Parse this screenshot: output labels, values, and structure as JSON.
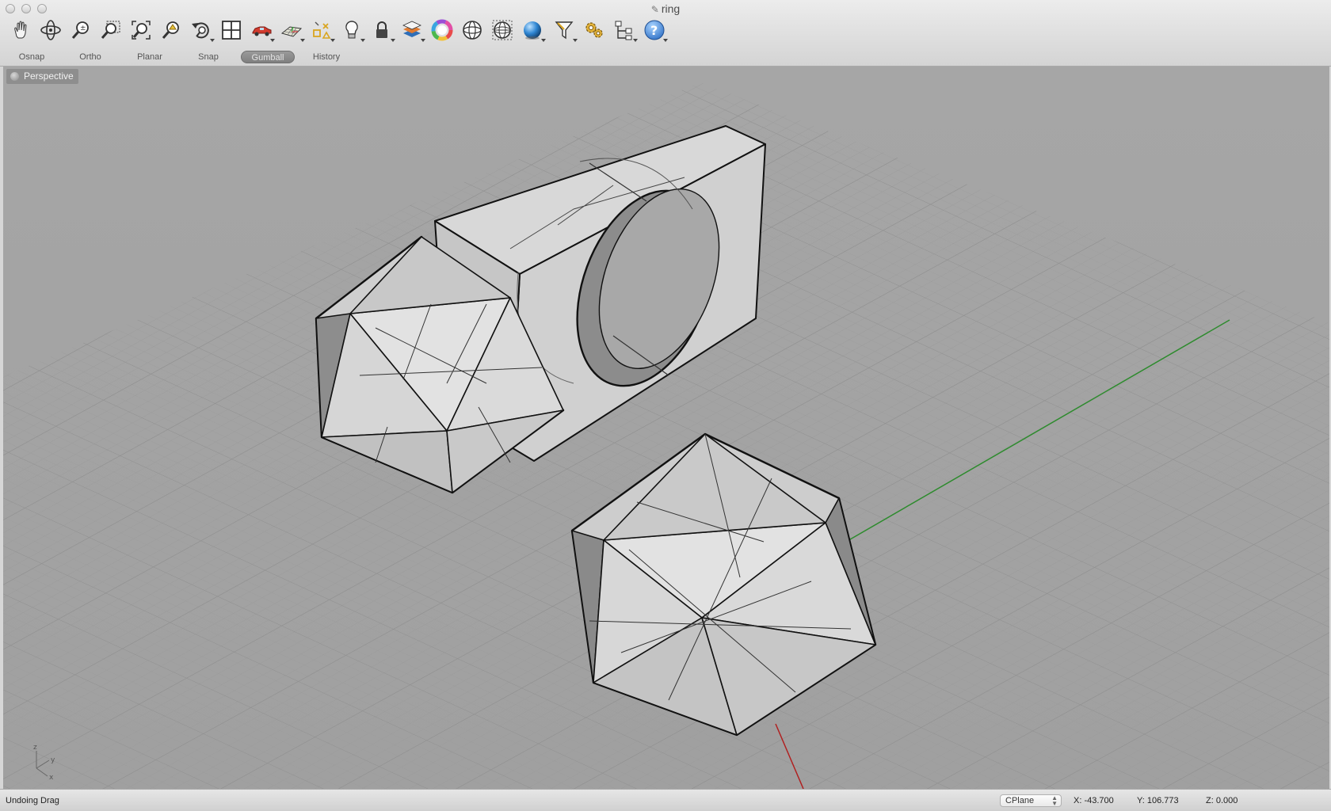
{
  "window": {
    "title": "ring"
  },
  "toolbar": {
    "tools": [
      {
        "icon": "pan-hand-icon",
        "caret": false
      },
      {
        "icon": "rotate-view-icon",
        "caret": false
      },
      {
        "icon": "zoom-icon",
        "caret": false
      },
      {
        "icon": "zoom-window-icon",
        "caret": false
      },
      {
        "icon": "zoom-extents-icon",
        "caret": false
      },
      {
        "icon": "zoom-selected-icon",
        "caret": false
      },
      {
        "icon": "undo-view-icon",
        "caret": true
      },
      {
        "icon": "viewport-layout-icon",
        "caret": false
      },
      {
        "icon": "car-render-icon",
        "caret": true
      },
      {
        "icon": "grid-plane-icon",
        "caret": true
      },
      {
        "icon": "object-snap-icon",
        "caret": true
      },
      {
        "icon": "lightbulb-icon",
        "caret": true
      },
      {
        "icon": "lock-icon",
        "caret": true
      },
      {
        "icon": "layer-icon",
        "caret": true
      },
      {
        "icon": "color-wheel-icon",
        "caret": false
      },
      {
        "icon": "sphere-wire-icon",
        "caret": false
      },
      {
        "icon": "globe-grid-icon",
        "caret": false
      },
      {
        "icon": "shaded-sphere-icon",
        "caret": true
      },
      {
        "icon": "filter-icon",
        "caret": true
      },
      {
        "icon": "settings-gears-icon",
        "caret": false
      },
      {
        "icon": "hierarchy-icon",
        "caret": true
      },
      {
        "icon": "help-icon",
        "caret": true
      }
    ]
  },
  "toggles": [
    {
      "label": "Osnap",
      "active": false
    },
    {
      "label": "Ortho",
      "active": false
    },
    {
      "label": "Planar",
      "active": false
    },
    {
      "label": "Snap",
      "active": false
    },
    {
      "label": "Gumball",
      "active": true
    },
    {
      "label": "History",
      "active": false
    }
  ],
  "viewport": {
    "name": "Perspective",
    "axes": {
      "x": "x",
      "y": "y",
      "z": "z"
    },
    "colors": {
      "background": "#a3a3a3",
      "grid": "#959595",
      "x_axis": "#b02020",
      "y_axis": "#2e8b2e"
    }
  },
  "status": {
    "message": "Undoing Drag",
    "cplane": "CPlane",
    "x": "X: -43.700",
    "y": "Y: 106.773",
    "z": "Z: 0.000"
  }
}
